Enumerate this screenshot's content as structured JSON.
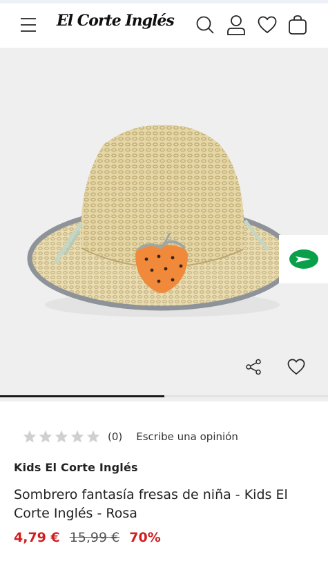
{
  "header": {
    "logo_text": "El Corte Inglés",
    "icons": [
      "menu-icon",
      "search-icon",
      "user-icon",
      "heart-icon",
      "shopping-bag-icon"
    ]
  },
  "gallery": {
    "image_alt": "Sombrero de paja con fresa",
    "progress_fraction": 0.5,
    "icons": [
      "share-icon",
      "heart-icon",
      "play-icon"
    ]
  },
  "rating": {
    "stars": 0,
    "max_stars": 5,
    "count": "(0)",
    "write_review": "Escribe una opinión"
  },
  "product": {
    "brand": "Kids El Corte Inglés",
    "title": "Sombrero fantasía fresas de niña - Kids El Corte Inglés - Rosa",
    "price_now": "4,79 €",
    "price_old": "15,99 €",
    "discount": "70%"
  },
  "colors": {
    "sale_red": "#d11f1f",
    "brand_green": "#0aa04a",
    "star_gray": "#d0d0d0",
    "image_background": "#efefef"
  }
}
